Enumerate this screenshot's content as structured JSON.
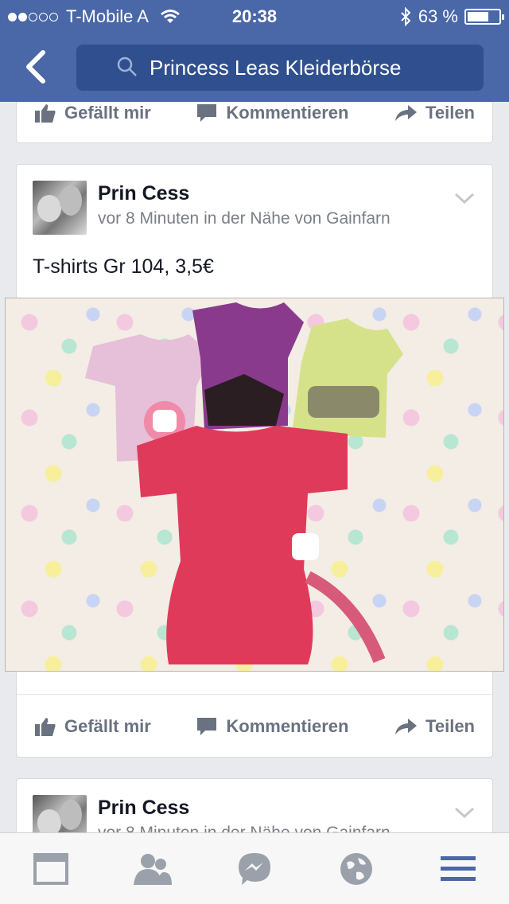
{
  "status_bar": {
    "carrier": "T-Mobile A",
    "time": "20:38",
    "battery": "63 %",
    "signal_bars": 2
  },
  "nav": {
    "search_text": "Princess Leas Kleiderbörse"
  },
  "actions": {
    "like": "Gefällt mir",
    "comment": "Kommentieren",
    "share": "Teilen"
  },
  "posts": [
    {
      "author": "Prin Cess",
      "meta": "vor 8 Minuten in der Nähe von Gainfarn",
      "text": "T-shirts Gr 104, 3,5€"
    },
    {
      "author": "Prin Cess",
      "meta": "vor 8 Minuten in der Nähe von Gainfarn"
    }
  ],
  "tabs": [
    {
      "icon": "news-feed-icon"
    },
    {
      "icon": "friend-requests-icon"
    },
    {
      "icon": "messenger-icon"
    },
    {
      "icon": "notifications-globe-icon"
    },
    {
      "icon": "more-menu-icon",
      "active": true
    }
  ],
  "colors": {
    "header": "#4a67a8",
    "search_field": "#2f4f8f",
    "action_text": "#6a7180",
    "active_tab": "#4a67a8",
    "inactive_tab": "#9ba1ab"
  }
}
